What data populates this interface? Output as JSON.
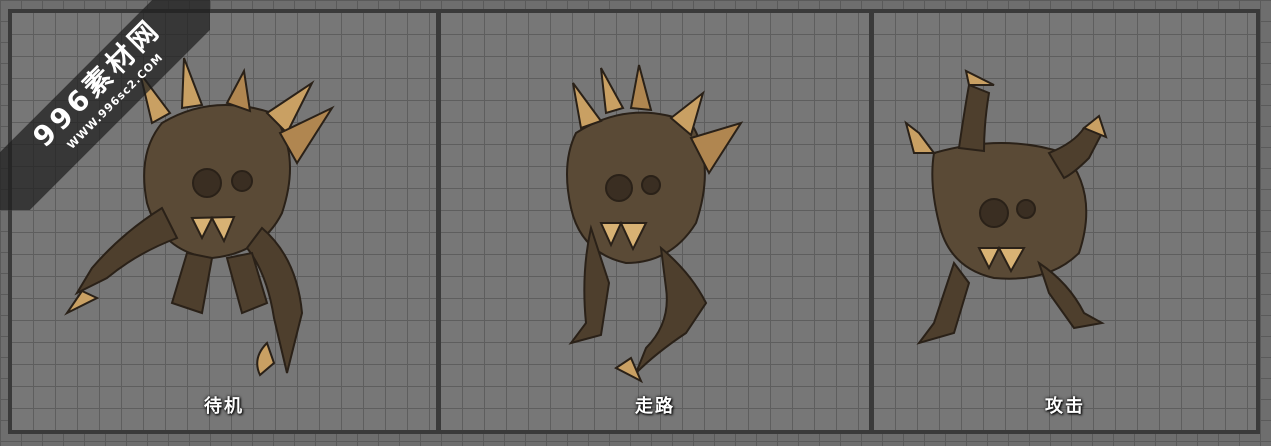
{
  "panels": [
    {
      "label": "待机",
      "creature": "idle"
    },
    {
      "label": "走路",
      "creature": "walk"
    },
    {
      "label": "攻击",
      "creature": "attack"
    }
  ],
  "watermark": {
    "title": "996素材网",
    "url": "WWW.996sc2.COM"
  },
  "colors": {
    "background": "#6e6e6e",
    "grid_line": "#5a5a5a",
    "frame": "#3a3a3a",
    "creature_bark": "#5a4a36",
    "creature_highlight": "#c9a063",
    "label_text": "#ffffff"
  }
}
